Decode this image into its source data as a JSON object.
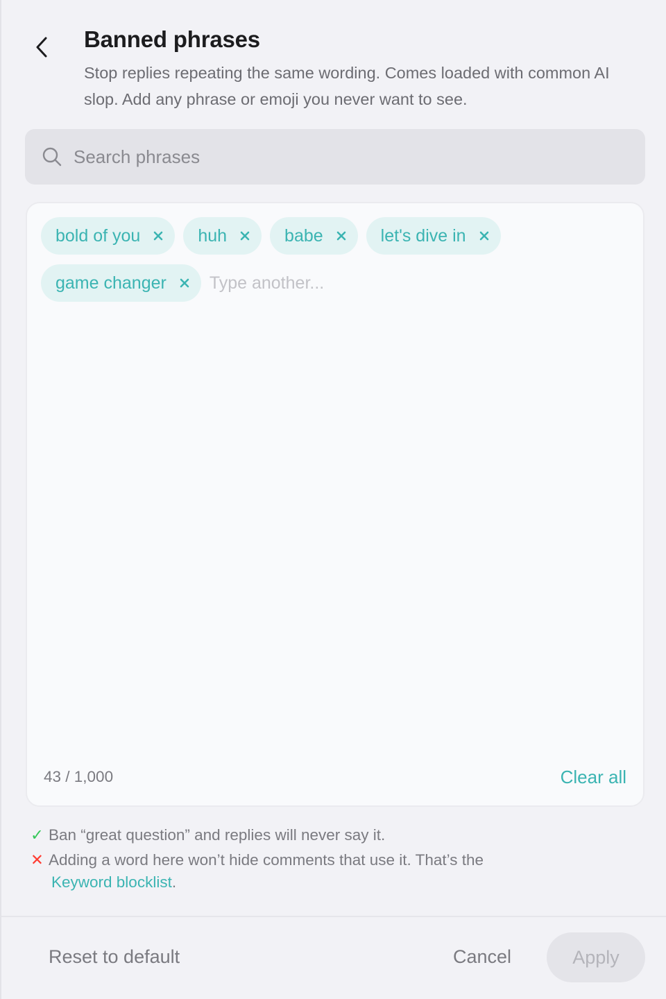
{
  "header": {
    "title": "Banned phrases",
    "subtitle": "Stop replies repeating the same wording. Comes loaded with common AI slop. Add any phrase or emoji you never want to see."
  },
  "search": {
    "placeholder": "Search phrases",
    "value": ""
  },
  "editor": {
    "phrases": [
      {
        "label": "bold of you"
      },
      {
        "label": "huh"
      },
      {
        "label": "babe"
      },
      {
        "label": "let's dive in"
      },
      {
        "label": "game changer"
      }
    ],
    "input_placeholder": "Type another...",
    "counter": "43 / 1,000",
    "clear_label": "Clear all"
  },
  "hints": {
    "positive": "Ban “great question” and replies will never say it.",
    "negative_line1": "Adding a word here won’t hide comments that use it. That’s the",
    "negative_link": "Keyword blocklist",
    "negative_end": "."
  },
  "footer": {
    "reset_label": "Reset to default",
    "cancel_label": "Cancel",
    "apply_label": "Apply"
  },
  "colors": {
    "accent": "#3bb4b2",
    "chip_bg": "#e2f3f3",
    "check": "#34c759",
    "cross": "#ff3b30"
  },
  "icons": {
    "back": "chevron-left-icon",
    "search": "search-icon",
    "chip_remove": "close-icon"
  }
}
